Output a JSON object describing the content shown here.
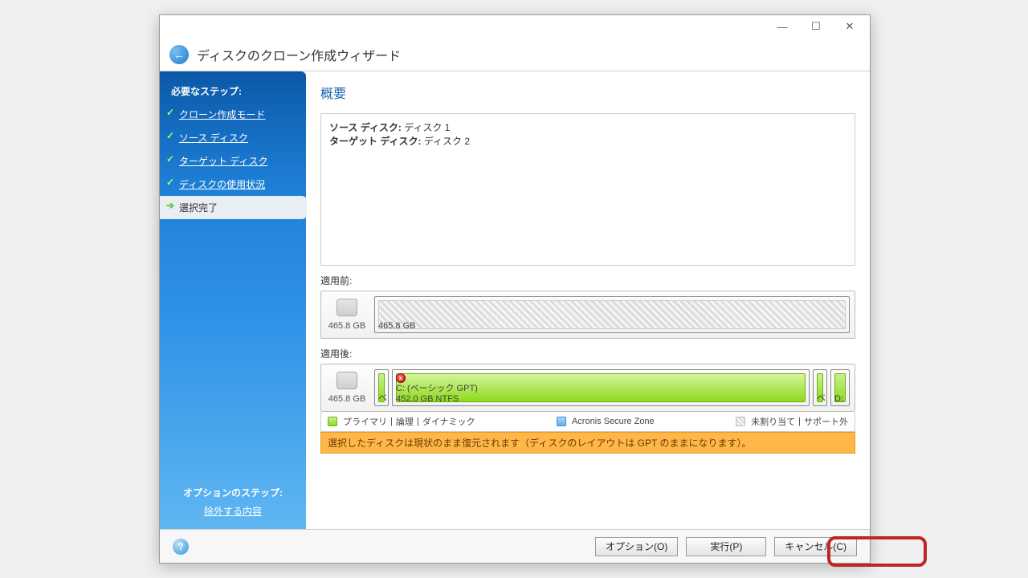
{
  "window": {
    "title": "ディスクのクローン作成ウィザード"
  },
  "sidebar": {
    "required_label": "必要なステップ:",
    "steps": [
      "クローン作成モード",
      "ソース ディスク",
      "ターゲット ディスク",
      "ディスクの使用状況"
    ],
    "current_step": "選択完了",
    "optional_label": "オプションのステップ:",
    "optional_link": "除外する内容"
  },
  "main": {
    "title": "概要",
    "summary": {
      "source_label": "ソース ディスク:",
      "source_value": "ディスク 1",
      "target_label": "ターゲット ディスク:",
      "target_value": "ディスク 2"
    },
    "before_label": "適用前:",
    "after_label": "適用後:",
    "before_disk": {
      "capacity": "465.8 GB",
      "unallocated_size": "465.8 GB"
    },
    "after_disk": {
      "capacity": "465.8 GB",
      "main_partition": {
        "name": "C: (ベーシック GPT)",
        "size": "452.0 GB  NTFS"
      },
      "left_label": "ベ...",
      "right1_label": "ベ...",
      "right2_label": "D:"
    },
    "legend": {
      "primary": "プライマリ",
      "logical": "論理",
      "dynamic": "ダイナミック",
      "zone": "Acronis Secure Zone",
      "unallocated": "未割り当て",
      "unsupported": "サポート外"
    },
    "notice": "選択したディスクは現状のまま復元されます（ディスクのレイアウトは GPT のままになります）。"
  },
  "footer": {
    "options": "オプション(O)",
    "proceed": "実行(P)",
    "cancel": "キャンセル(C)"
  }
}
